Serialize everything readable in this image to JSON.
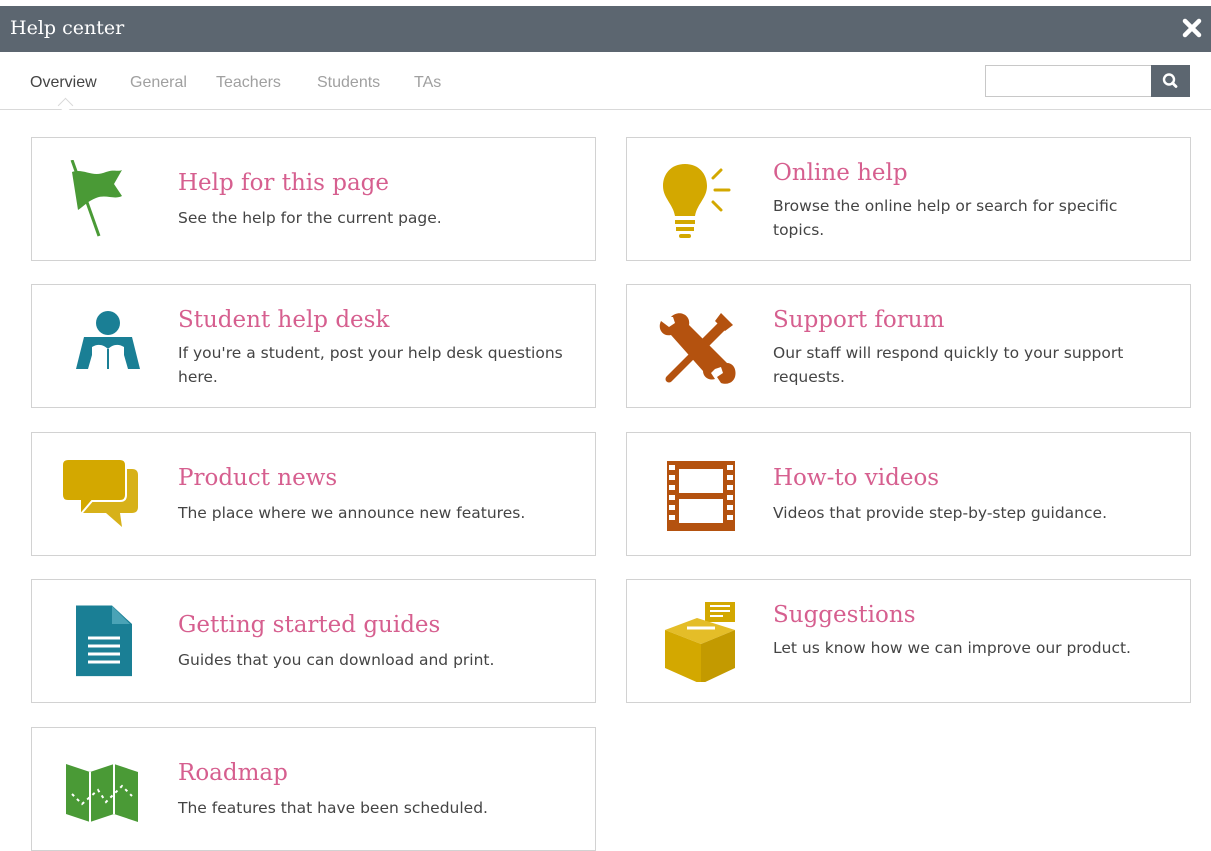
{
  "header": {
    "title": "Help center",
    "close_icon": "close-icon"
  },
  "tabs": [
    {
      "label": "Overview",
      "active": true
    },
    {
      "label": "General"
    },
    {
      "label": "Teachers"
    },
    {
      "label": "Students"
    },
    {
      "label": "TAs"
    }
  ],
  "search": {
    "value": "",
    "placeholder": "",
    "button_icon": "search-icon"
  },
  "colors": {
    "title_bar": "#5c6670",
    "card_title": "#d65f8f",
    "green": "#4a9a36",
    "gold": "#d3a800",
    "teal": "#1a7f95",
    "rust": "#b4520f"
  },
  "cards": [
    {
      "title": "Help for this page",
      "desc": "See the help for the current page.",
      "icon": "flag-icon"
    },
    {
      "title": "Online help",
      "desc": "Browse the online help or search for specific topics.",
      "icon": "lightbulb-icon"
    },
    {
      "title": "Student help desk",
      "desc": "If you're a student, post your help desk questions here.",
      "icon": "student-reading-icon"
    },
    {
      "title": "Support forum",
      "desc": "Our staff will respond quickly to your support requests.",
      "icon": "tools-icon"
    },
    {
      "title": "Product news",
      "desc": "The place where we announce new features.",
      "icon": "speech-bubbles-icon"
    },
    {
      "title": "How-to videos",
      "desc": "Videos that provide step-by-step guidance.",
      "icon": "film-strip-icon"
    },
    {
      "title": "Getting started guides",
      "desc": "Guides that you can download and print.",
      "icon": "document-icon"
    },
    {
      "title": "Suggestions",
      "desc": "Let us know how we can improve our product.",
      "icon": "suggestion-box-icon"
    },
    {
      "title": "Roadmap",
      "desc": "The features that have been scheduled.",
      "icon": "map-icon"
    }
  ]
}
